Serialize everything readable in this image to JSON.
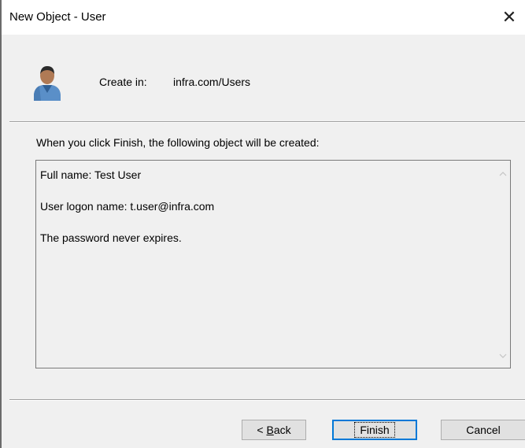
{
  "window": {
    "title": "New Object - User",
    "close_glyph": "✕"
  },
  "header": {
    "icon": "user-icon",
    "create_in_label": "Create in:",
    "create_in_value": "infra.com/Users"
  },
  "main": {
    "intro": "When you click Finish, the following object will be created:",
    "summary_lines": [
      "Full name: Test User",
      "User logon name: t.user@infra.com",
      "The password never expires."
    ]
  },
  "buttons": {
    "back_prefix": "< ",
    "back_accel": "B",
    "back_rest": "ack",
    "finish": "Finish",
    "cancel": "Cancel"
  },
  "colors": {
    "focus_border": "#0078d7",
    "face": "#f0f0f0"
  }
}
